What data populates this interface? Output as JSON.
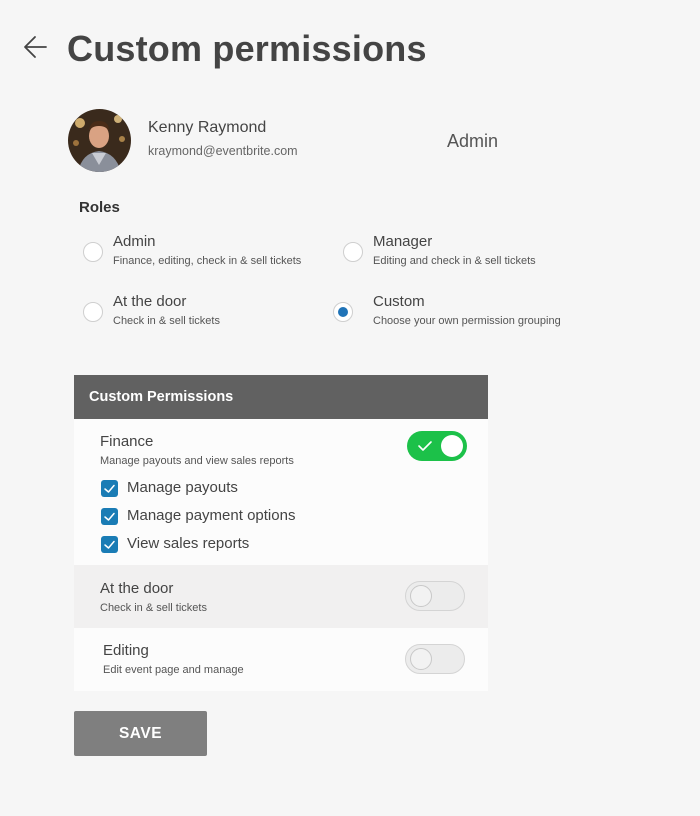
{
  "header": {
    "title": "Custom permissions"
  },
  "user": {
    "name": "Kenny Raymond",
    "email": "kraymond@eventbrite.com",
    "role": "Admin"
  },
  "roles": {
    "heading": "Roles",
    "options": [
      {
        "label": "Admin",
        "description": "Finance, editing, check in & sell tickets",
        "selected": false
      },
      {
        "label": "Manager",
        "description": "Editing and check in & sell tickets",
        "selected": false
      },
      {
        "label": "At the door",
        "description": "Check in & sell tickets",
        "selected": false
      },
      {
        "label": "Custom",
        "description": "Choose your own permission grouping",
        "selected": true
      }
    ]
  },
  "permissions": {
    "heading": "Custom Permissions",
    "finance": {
      "title": "Finance",
      "description": "Manage payouts and view sales reports",
      "enabled": true,
      "items": [
        {
          "label": "Manage payouts",
          "checked": true
        },
        {
          "label": "Manage payment options",
          "checked": true
        },
        {
          "label": "View sales reports",
          "checked": true
        }
      ]
    },
    "at_the_door": {
      "title": "At the door",
      "description": "Check in & sell tickets",
      "enabled": false
    },
    "editing": {
      "title": "Editing",
      "description": "Edit event page and manage",
      "enabled": false
    }
  },
  "actions": {
    "save_label": "SAVE"
  },
  "colors": {
    "accent_blue": "#1f73b7",
    "toggle_on": "#1cc149",
    "panel_header": "#616161",
    "save_button": "#7f7f7f"
  }
}
